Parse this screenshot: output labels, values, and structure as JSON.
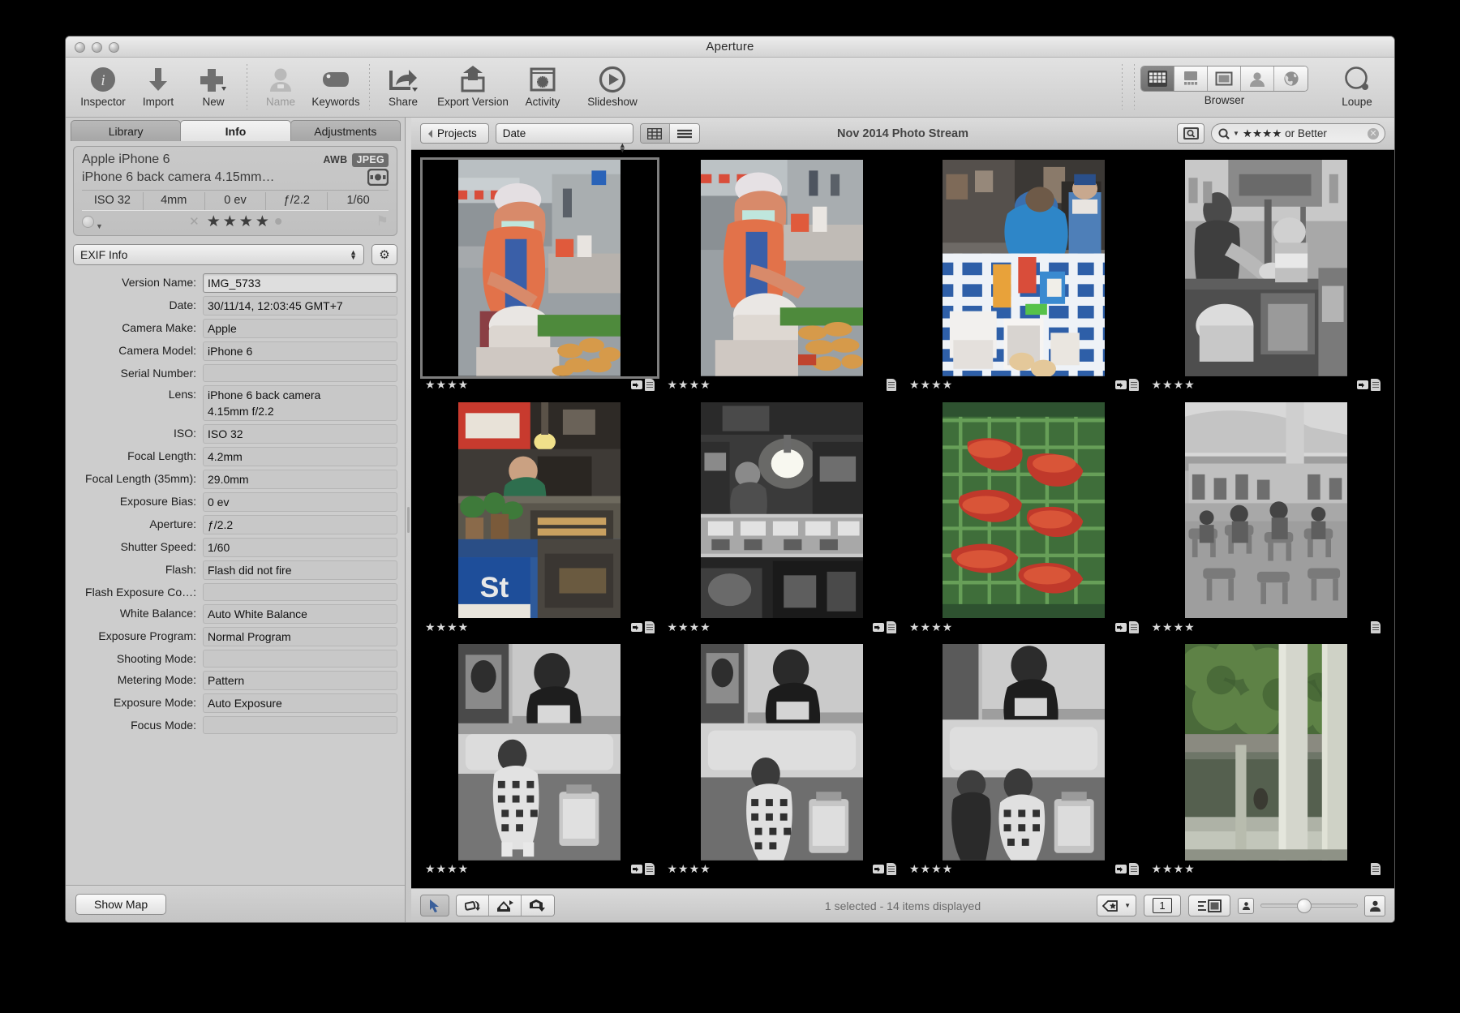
{
  "window": {
    "title": "Aperture"
  },
  "toolbar": {
    "items": [
      {
        "label": "Inspector",
        "icon": "info-circle-icon",
        "dim": false
      },
      {
        "label": "Import",
        "icon": "download-arrow-icon",
        "dim": false
      },
      {
        "label": "New",
        "icon": "plus-icon",
        "dim": false
      },
      {
        "label": "Name",
        "icon": "person-icon",
        "dim": true
      },
      {
        "label": "Keywords",
        "icon": "tag-icon",
        "dim": false
      },
      {
        "label": "Share",
        "icon": "share-arrow-icon",
        "dim": false
      },
      {
        "label": "Export Version",
        "icon": "export-upload-icon",
        "dim": false
      },
      {
        "label": "Activity",
        "icon": "activity-spinner-icon",
        "dim": false
      },
      {
        "label": "Slideshow",
        "icon": "play-circle-icon",
        "dim": false
      }
    ],
    "browser_label": "Browser",
    "loupe_label": "Loupe",
    "view_modes": [
      {
        "name": "grid-view-icon",
        "selected": true
      },
      {
        "name": "filmstrip-view-icon",
        "selected": false
      },
      {
        "name": "viewer-only-icon",
        "selected": false
      },
      {
        "name": "faces-view-icon",
        "selected": false
      },
      {
        "name": "places-globe-icon",
        "selected": false
      }
    ]
  },
  "inspector": {
    "tabs": [
      {
        "label": "Library",
        "active": false
      },
      {
        "label": "Info",
        "active": true
      },
      {
        "label": "Adjustments",
        "active": false
      }
    ],
    "meta_card": {
      "camera": "Apple iPhone 6",
      "lens": "iPhone 6 back camera 4.15mm…",
      "awb": "AWB",
      "format": "JPEG",
      "stats": [
        "ISO 32",
        "4mm",
        "0 ev",
        "ƒ/2.2",
        "1/60"
      ],
      "rating_stars": 4,
      "rating_max": 5
    },
    "metadata_set": "EXIF Info",
    "fields": [
      {
        "label": "Version Name:",
        "value": "IMG_5733",
        "focused": true
      },
      {
        "label": "Date:",
        "value": "30/11/14, 12:03:45 GMT+7",
        "focused": false
      },
      {
        "label": "Camera Make:",
        "value": "Apple",
        "focused": false
      },
      {
        "label": "Camera Model:",
        "value": "iPhone 6",
        "focused": false
      },
      {
        "label": "Serial Number:",
        "value": "",
        "focused": false
      },
      {
        "label": "Lens:",
        "value": "iPhone 6 back camera\n4.15mm f/2.2",
        "focused": false,
        "two_line": true
      },
      {
        "label": "ISO:",
        "value": "ISO 32",
        "focused": false
      },
      {
        "label": "Focal Length:",
        "value": "4.2mm",
        "focused": false
      },
      {
        "label": "Focal Length (35mm):",
        "value": "29.0mm",
        "focused": false
      },
      {
        "label": "Exposure Bias:",
        "value": "0 ev",
        "focused": false
      },
      {
        "label": "Aperture:",
        "value": "ƒ/2.2",
        "focused": false
      },
      {
        "label": "Shutter Speed:",
        "value": "1/60",
        "focused": false
      },
      {
        "label": "Flash:",
        "value": "Flash did not fire",
        "focused": false
      },
      {
        "label": "Flash Exposure Co…:",
        "value": "",
        "focused": false
      },
      {
        "label": "White Balance:",
        "value": "Auto White Balance",
        "focused": false
      },
      {
        "label": "Exposure Program:",
        "value": "Normal Program",
        "focused": false
      },
      {
        "label": "Shooting Mode:",
        "value": "",
        "focused": false
      },
      {
        "label": "Metering Mode:",
        "value": "Pattern",
        "focused": false
      },
      {
        "label": "Exposure Mode:",
        "value": "Auto Exposure",
        "focused": false
      },
      {
        "label": "Focus Mode:",
        "value": "",
        "focused": false
      }
    ],
    "show_map_label": "Show Map"
  },
  "browser": {
    "back_label": "Projects",
    "sort_value": "Date",
    "title": "Nov 2014 Photo Stream",
    "search_text": "★★★★ or Better",
    "layout_modes": [
      {
        "name": "grid-layout-icon",
        "selected": true
      },
      {
        "name": "list-layout-icon",
        "selected": false
      }
    ],
    "thumbnails": [
      {
        "stars": "★★★★",
        "orientation": "portrait",
        "selected": true,
        "badge_adjust": true,
        "badge_doc": true,
        "scene": "street-vendor-color-1"
      },
      {
        "stars": "★★★★",
        "orientation": "portrait",
        "selected": false,
        "badge_adjust": false,
        "badge_doc": true,
        "scene": "street-vendor-color-2"
      },
      {
        "stars": "★★★★",
        "orientation": "portrait",
        "selected": false,
        "badge_adjust": true,
        "badge_doc": true,
        "scene": "food-stall-blue-table"
      },
      {
        "stars": "★★★★",
        "orientation": "portrait",
        "selected": false,
        "badge_adjust": true,
        "badge_doc": true,
        "scene": "bw-market-hands"
      },
      {
        "stars": "★★★★",
        "orientation": "portrait",
        "selected": false,
        "badge_adjust": true,
        "badge_doc": true,
        "scene": "night-stall-signs"
      },
      {
        "stars": "★★★★",
        "orientation": "portrait",
        "selected": false,
        "badge_adjust": true,
        "badge_doc": true,
        "scene": "bw-night-kitchen"
      },
      {
        "stars": "★★★★",
        "orientation": "portrait",
        "selected": false,
        "badge_adjust": true,
        "badge_doc": true,
        "scene": "grilled-pork-green-mat"
      },
      {
        "stars": "★★★★",
        "orientation": "portrait",
        "selected": false,
        "badge_adjust": false,
        "badge_doc": true,
        "scene": "bw-food-court"
      },
      {
        "stars": "★★★★",
        "orientation": "portrait",
        "selected": false,
        "badge_adjust": true,
        "badge_doc": true,
        "scene": "bw-train-child-1"
      },
      {
        "stars": "★★★★",
        "orientation": "portrait",
        "selected": false,
        "badge_adjust": true,
        "badge_doc": true,
        "scene": "bw-train-child-2"
      },
      {
        "stars": "★★★★",
        "orientation": "portrait",
        "selected": false,
        "badge_adjust": true,
        "badge_doc": true,
        "scene": "bw-train-child-3"
      },
      {
        "stars": "★★★★",
        "orientation": "portrait",
        "selected": false,
        "badge_adjust": false,
        "badge_doc": true,
        "scene": "canal-green-wall"
      }
    ]
  },
  "statusbar": {
    "status_text": "1 selected - 14 items displayed",
    "tools": [
      {
        "name": "arrow-select-tool",
        "selected": true
      },
      {
        "name": "rotate-ccw-tool",
        "selected": false
      },
      {
        "name": "lift-tool",
        "selected": false
      },
      {
        "name": "stamp-tool",
        "selected": false
      }
    ],
    "right_buttons": [
      {
        "name": "rating-overlay-button",
        "label": ""
      },
      {
        "name": "page-count-button",
        "label": "1"
      },
      {
        "name": "metadata-overlay-button",
        "label": ""
      }
    ]
  }
}
